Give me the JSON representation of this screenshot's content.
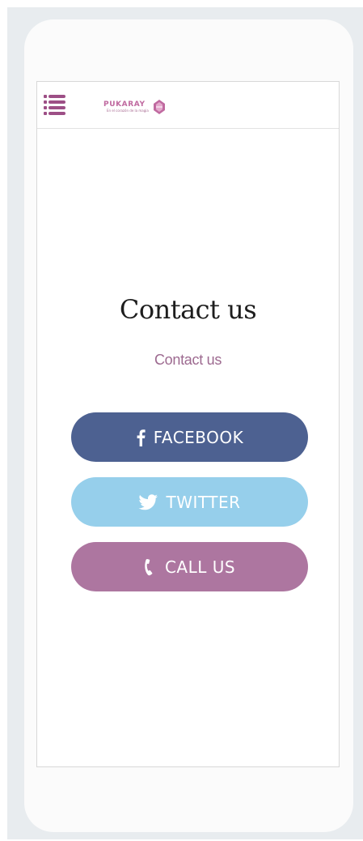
{
  "header": {
    "logo_name": "PUKARAY",
    "logo_tagline": "En el corazón de la magia"
  },
  "main": {
    "title": "Contact us",
    "subtitle": "Contact us"
  },
  "buttons": {
    "facebook": {
      "label": "FACEBOOK",
      "icon": "facebook-icon",
      "color": "#4d6191"
    },
    "twitter": {
      "label": "TWITTER",
      "icon": "twitter-bird-icon",
      "color": "#96cfeb"
    },
    "call": {
      "label": "CALL US",
      "icon": "phone-icon",
      "color": "#ad76a0"
    }
  },
  "colors": {
    "brand": "#c06aa0",
    "menu_icon": "#9d4f86",
    "subtitle": "#9d6a90"
  }
}
